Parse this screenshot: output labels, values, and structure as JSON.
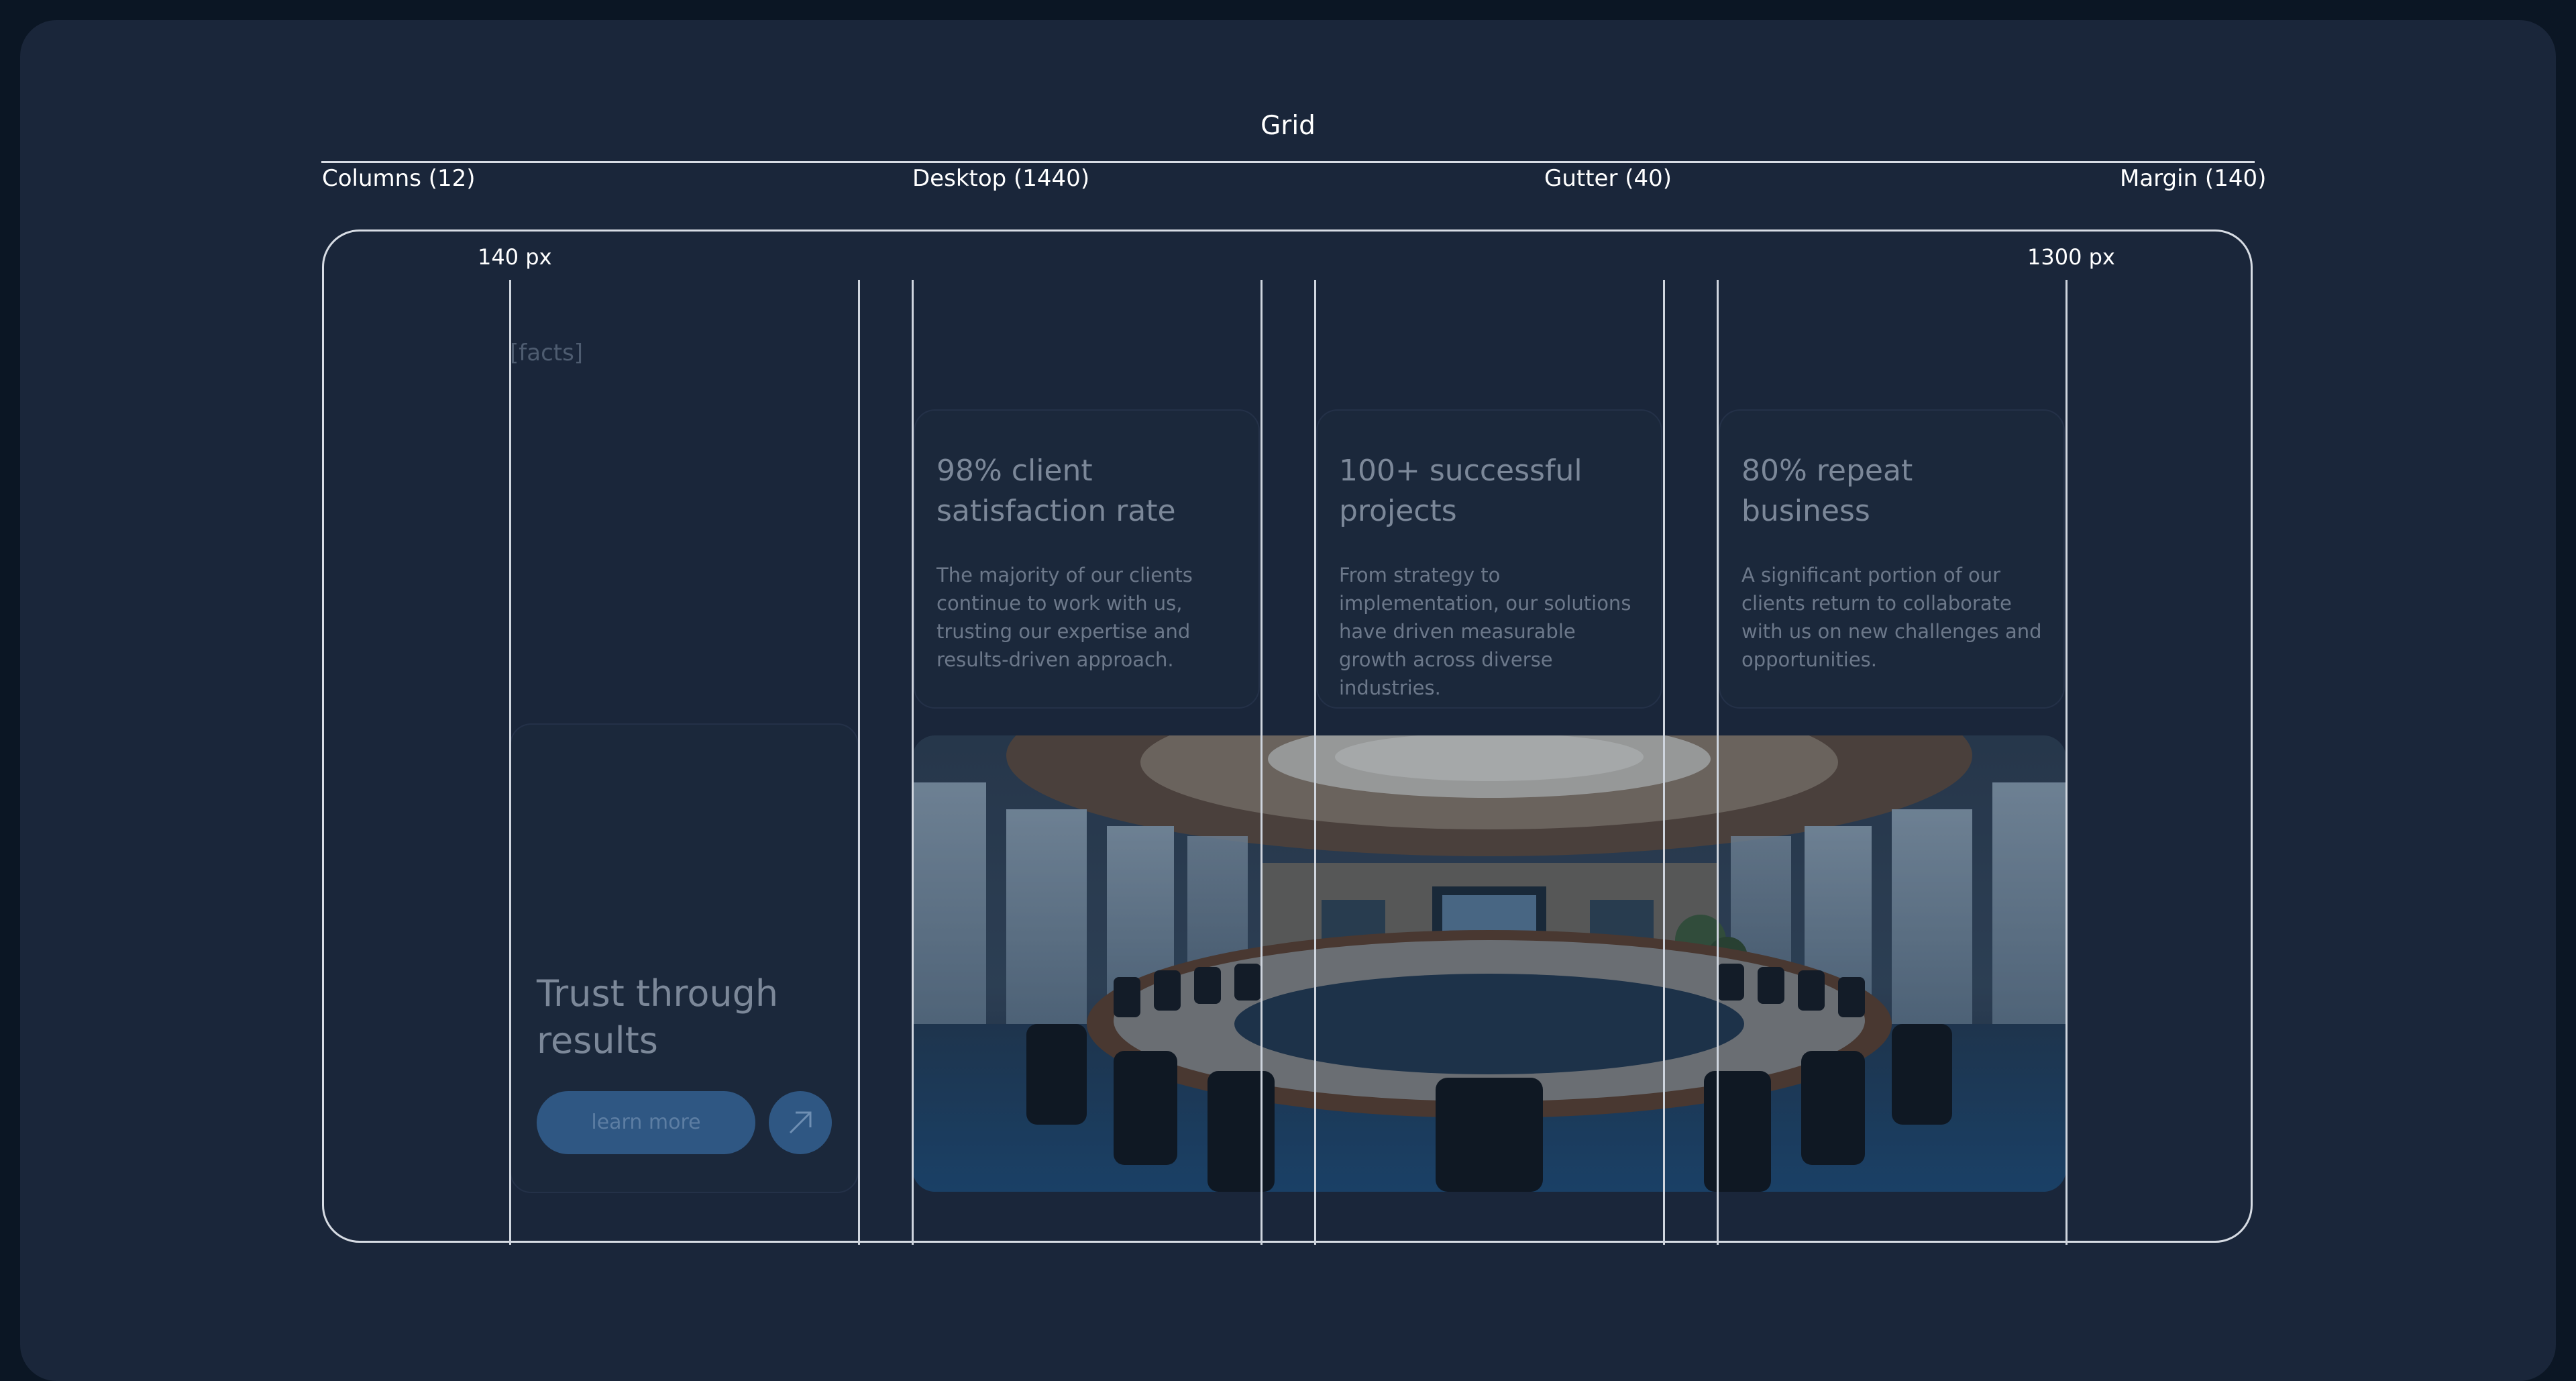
{
  "header": {
    "title": "Grid",
    "columns_label": "Columns (12)",
    "desktop_label": "Desktop (1440)",
    "gutter_label": "Gutter (40)",
    "margin_label": "Margin (140)"
  },
  "frame": {
    "left_marker": "140 px",
    "right_marker": "1300 px"
  },
  "section_tag": "[facts]",
  "stats": [
    {
      "title": "98% client satisfaction rate",
      "description": "The majority of our clients continue to work with us, trusting our expertise and results-driven approach."
    },
    {
      "title": "100+ successful projects",
      "description": "From strategy to implementation, our solutions have driven measurable growth across diverse industries."
    },
    {
      "title": "80% repeat business",
      "description": "A significant portion of our clients return to collaborate with us on new challenges and opportunities."
    }
  ],
  "cta": {
    "title": "Trust through results",
    "button_label": "learn more",
    "arrow_icon": "arrow-up-right-icon"
  },
  "photo": {
    "subject": "conference-room-image"
  },
  "colors": {
    "page_background": "#0b1624",
    "canvas_background": "#1a263a",
    "guide_line": "#cfd5de",
    "button_fill": "#2f5783"
  }
}
